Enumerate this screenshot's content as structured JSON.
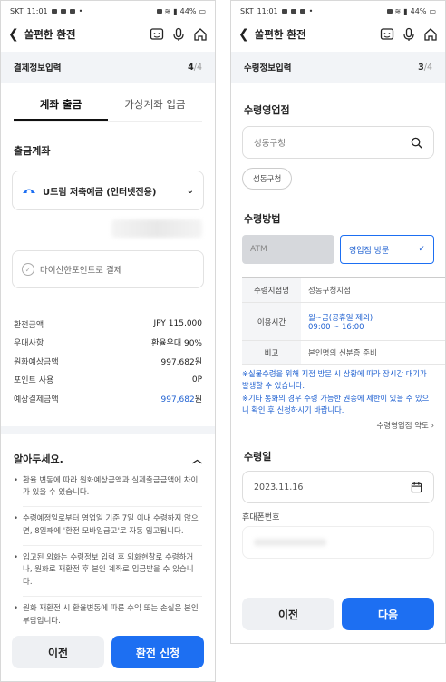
{
  "status": {
    "carrier": "SKT",
    "time": "11:01",
    "battery": "44%"
  },
  "left": {
    "header_title": "쏠편한 환전",
    "step_title": "결제정보입력",
    "step_current": "4",
    "step_total": "/4",
    "tabs": [
      "계좌 출금",
      "가상계좌 입금"
    ],
    "account_label": "출금계좌",
    "account_name": "U드림 저축예금 (인터넷전용)",
    "point_label": "마이신한포인트로 결제",
    "rows": [
      {
        "k": "환전금액",
        "v": "JPY 115,000"
      },
      {
        "k": "우대사항",
        "v": "환율우대 90%"
      },
      {
        "k": "원화예상금액",
        "v": "997,682원"
      },
      {
        "k": "포인트 사용",
        "v": "0P"
      }
    ],
    "total_label": "예상결제금액",
    "total_value": "997,682",
    "total_unit": "원",
    "notice_title": "알아두세요.",
    "notices": [
      "환율 변동에 따라 원화예상금액과 실제출금금액에 차이가 있을 수 있습니다.",
      "수령예정일로부터 영업일 기준 7일 이내 수령하지 않으면, 8일째에 '환전 모바일금고'로 자동 입고됩니다.",
      "입고된 외화는 수령정보 입력 후 외화현찰로 수령하거나, 원화로 재환전 후 본인 계좌로 입금받을 수 있습니다.",
      "원화 재환전 시 환율변동에 따른 수익 또는 손실은 본인 부담입니다."
    ],
    "btn_prev": "이전",
    "btn_next": "환전 신청"
  },
  "right": {
    "header_title": "쏠편한 환전",
    "step_title": "수령정보입력",
    "step_current": "3",
    "step_total": "/4",
    "branch_label": "수령영업점",
    "branch_search": "성동구청",
    "branch_chip": "성동구청",
    "method_label": "수령방법",
    "method_atm": "ATM",
    "method_visit": "영업점 방문",
    "table": [
      {
        "k": "수령지점명",
        "v": "성동구청지점"
      },
      {
        "k": "이용시간",
        "v": "월~금(공휴일 제외)",
        "v2": "09:00 ~ 16:00"
      },
      {
        "k": "비고",
        "v": "본인명의 신분증 준비"
      }
    ],
    "note1": "※실물수령을 위해 지점 방문 시 상황에 따라 장시간 대기가 발생할 수 있습니다.",
    "note2": "※기타 통화의 경우 수령 가능한 권종에 제한이 있을 수 있으니 확인 후 신청하시기 바랍니다.",
    "terms": "수령영업점 약도",
    "date_label": "수령일",
    "date_value": "2023.11.16",
    "phone_label": "휴대폰번호",
    "btn_prev": "이전",
    "btn_next": "다음"
  },
  "colors": {
    "primary": "#1d6ff2",
    "link": "#1d5fd0",
    "bg_step": "#f2f4f7"
  }
}
